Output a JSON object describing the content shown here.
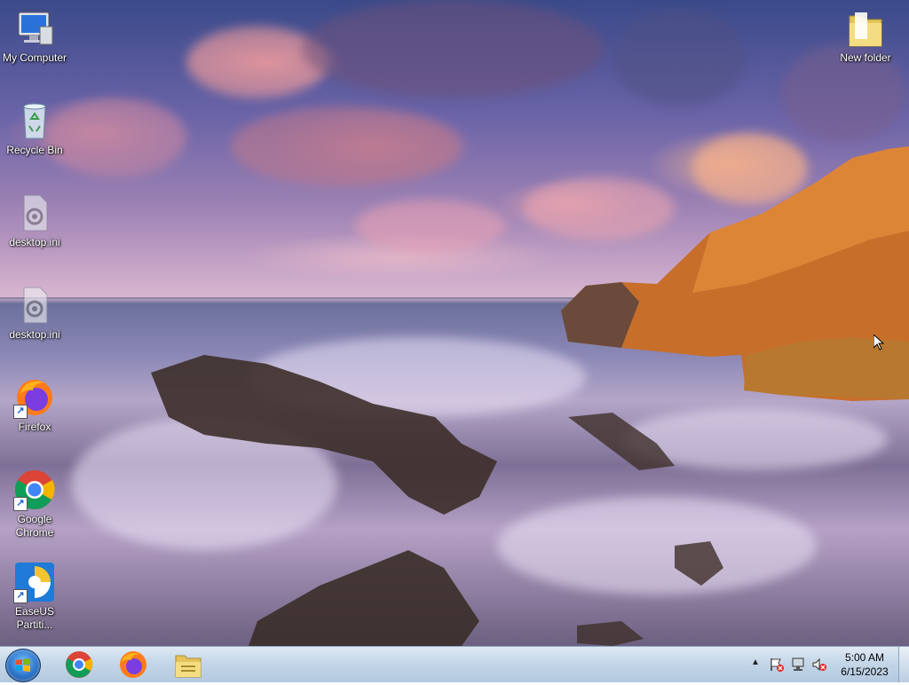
{
  "desktop": {
    "icons": [
      {
        "name": "my-computer",
        "label": "My Computer"
      },
      {
        "name": "recycle-bin",
        "label": "Recycle Bin"
      },
      {
        "name": "desktop-ini-1",
        "label": "desktop.ini"
      },
      {
        "name": "desktop-ini-2",
        "label": "desktop.ini"
      },
      {
        "name": "firefox",
        "label": "Firefox"
      },
      {
        "name": "google-chrome",
        "label": "Google Chrome"
      },
      {
        "name": "easeus",
        "label": "EaseUS Partiti..."
      },
      {
        "name": "new-folder",
        "label": "New folder"
      }
    ]
  },
  "taskbar": {
    "pinned": [
      "google-chrome-icon",
      "firefox-icon",
      "file-explorer-icon"
    ],
    "tray": {
      "icons": [
        "show-hidden-icons-chevron",
        "action-center-flag-icon",
        "network-icon",
        "volume-muted-icon"
      ],
      "time": "5:00 AM",
      "date": "6/15/2023"
    }
  },
  "colors": {
    "taskbar": "#c4d6e8",
    "start_orb": "#2b74c9"
  }
}
